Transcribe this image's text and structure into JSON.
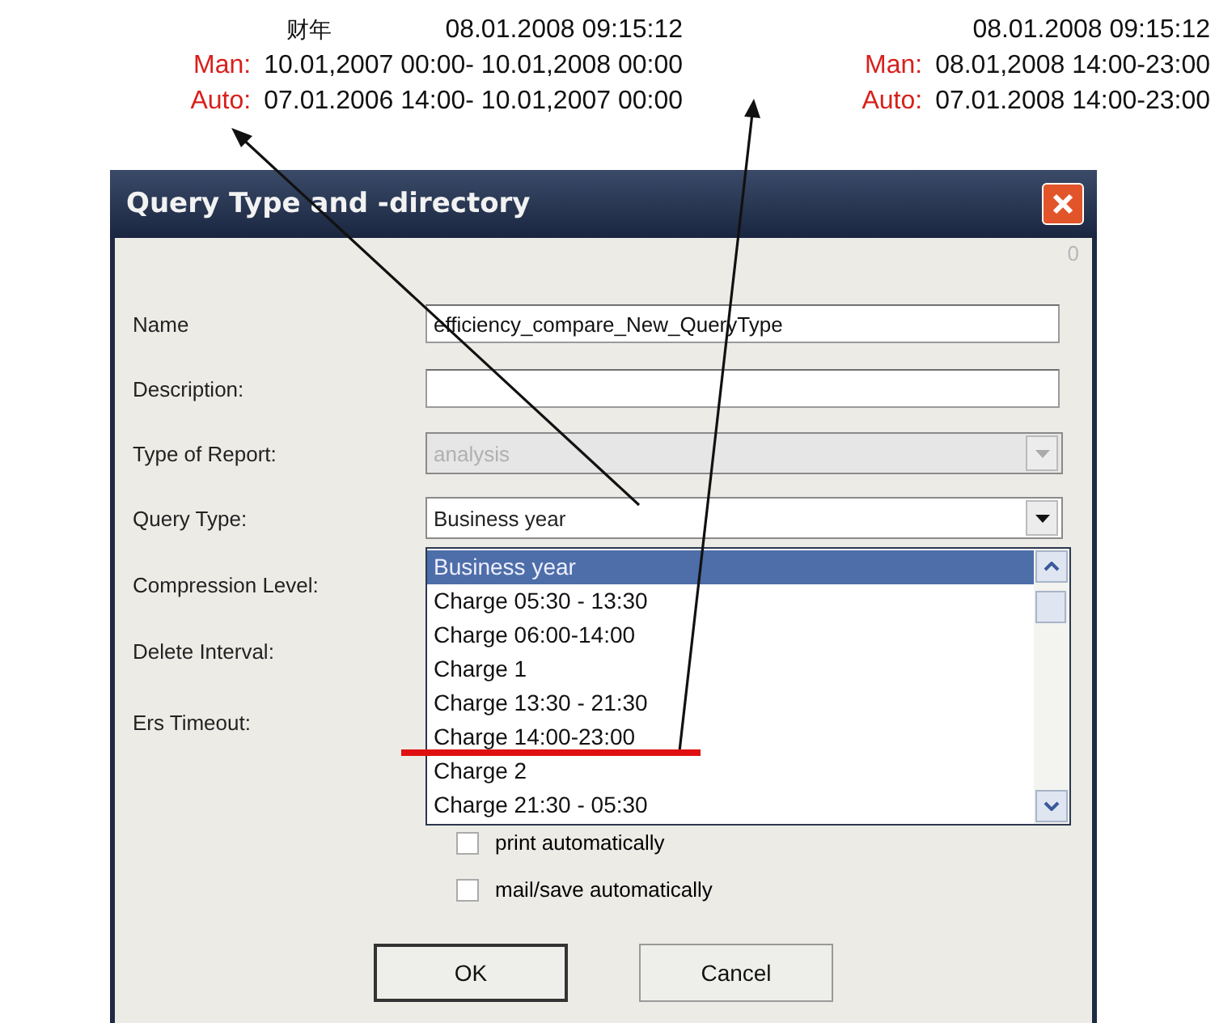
{
  "annotations": [
    {
      "header_label": "财年",
      "timestamp": "08.01.2008 09:15:12",
      "lines": [
        {
          "label": "Man:",
          "value": "10.01,2007 00:00- 10.01,2008 00:00"
        },
        {
          "label": "Auto:",
          "value": "07.01.2006 14:00- 10.01,2007 00:00"
        }
      ]
    },
    {
      "timestamp": "08.01.2008 09:15:12",
      "lines": [
        {
          "label": "Man:",
          "value": "08.01,2008 14:00-23:00"
        },
        {
          "label": "Auto:",
          "value": "07.01.2008 14:00-23:00"
        }
      ]
    }
  ],
  "dialog": {
    "title": "Query Type and -directory",
    "counter": "0",
    "fields": [
      {
        "label": "Name",
        "kind": "text",
        "value": "efficiency_compare_New_QueryType"
      },
      {
        "label": "Description:",
        "kind": "text"
      },
      {
        "label": "Type of Report:",
        "kind": "combo",
        "value": "analysis",
        "disabled": true
      },
      {
        "label": "Query Type:",
        "kind": "combo",
        "value": "Business year",
        "disabled": false
      },
      {
        "label": "Compression Level:",
        "kind": "hidden"
      },
      {
        "label": "Delete Interval:",
        "kind": "hidden"
      },
      {
        "label": "Ers Timeout:",
        "kind": "hidden"
      }
    ],
    "dropdown_items": [
      {
        "label": "Business year",
        "selected": true
      },
      {
        "label": "Charge 05:30 - 13:30",
        "selected": false
      },
      {
        "label": "Charge 06:00-14:00",
        "selected": false
      },
      {
        "label": "Charge 1",
        "selected": false
      },
      {
        "label": "Charge 13:30 - 21:30",
        "selected": false
      },
      {
        "label": "Charge 14:00-23:00",
        "selected": false
      },
      {
        "label": "Charge 2",
        "selected": false
      },
      {
        "label": "Charge 21:30 - 05:30",
        "selected": false
      }
    ],
    "checkboxes": [
      {
        "label": "print automatically",
        "checked": false
      },
      {
        "label": "mail/save automatically",
        "checked": false
      }
    ],
    "buttons": [
      {
        "label": "OK",
        "default": true
      },
      {
        "label": "Cancel",
        "default": false
      }
    ]
  }
}
